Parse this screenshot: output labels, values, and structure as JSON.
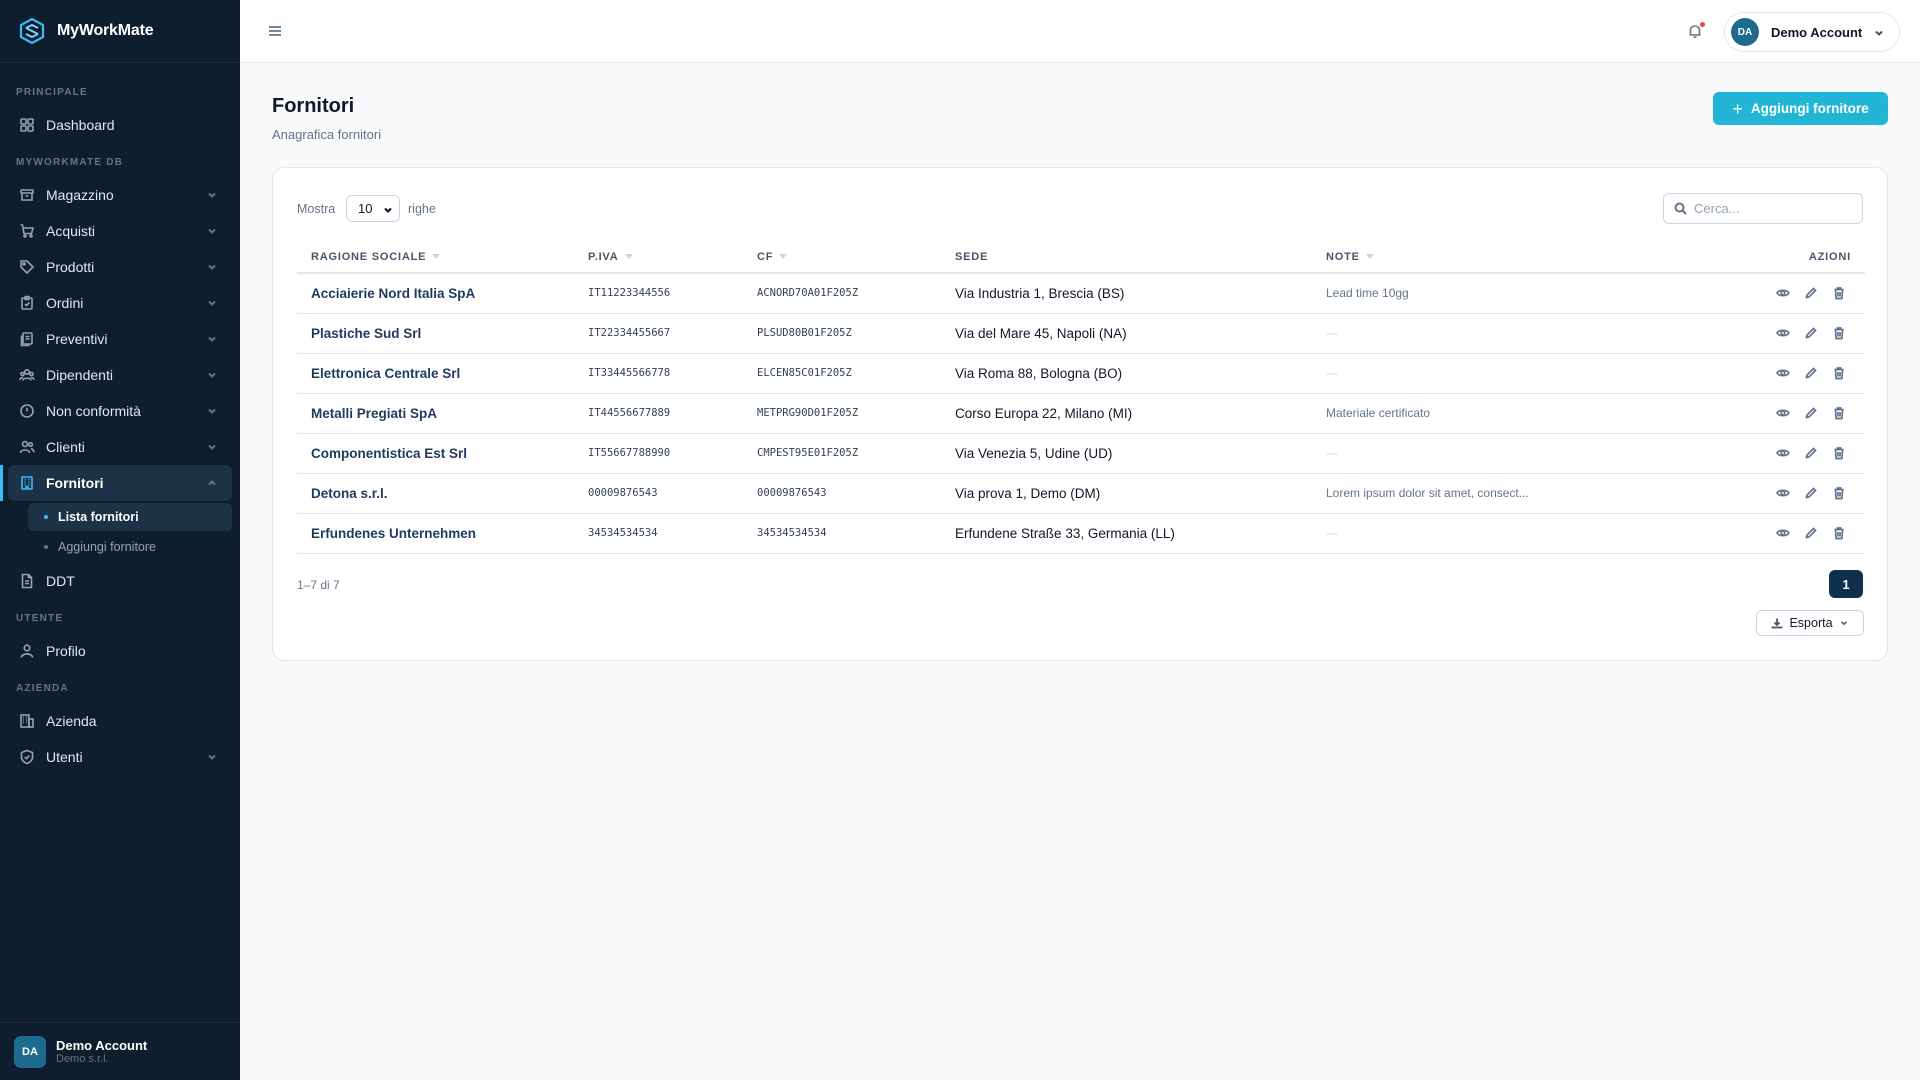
{
  "app": {
    "name": "MyWorkMate"
  },
  "sidebar": {
    "sections": {
      "principale": "PRINCIPALE",
      "db": "MYWORKMATE DB",
      "utente": "UTENTE",
      "azienda": "AZIENDA"
    },
    "items": {
      "dashboard": "Dashboard",
      "magazzino": "Magazzino",
      "acquisti": "Acquisti",
      "prodotti": "Prodotti",
      "ordini": "Ordini",
      "preventivi": "Preventivi",
      "dipendenti": "Dipendenti",
      "non_conformita": "Non conformità",
      "clienti": "Clienti",
      "fornitori": "Fornitori",
      "lista_fornitori": "Lista fornitori",
      "aggiungi_fornitore": "Aggiungi fornitore",
      "ddt": "DDT",
      "profilo": "Profilo",
      "azienda": "Azienda",
      "utenti": "Utenti"
    },
    "footer": {
      "initials": "DA",
      "name": "Demo Account",
      "company": "Demo s.r.l."
    }
  },
  "topbar": {
    "account_initials": "DA",
    "account_name": "Demo Account"
  },
  "page": {
    "title": "Fornitori",
    "subtitle": "Anagrafica fornitori",
    "add_button": "Aggiungi fornitore"
  },
  "table_controls": {
    "show_label": "Mostra",
    "rows_per_page": "10",
    "rows_label": "righe",
    "search_placeholder": "Cerca..."
  },
  "table": {
    "headers": {
      "ragione_sociale": "RAGIONE SOCIALE",
      "piva": "P.IVA",
      "cf": "CF",
      "sede": "SEDE",
      "note": "NOTE",
      "azioni": "AZIONI"
    },
    "rows": [
      {
        "name": "Acciaierie Nord Italia SpA",
        "piva": "IT11223344556",
        "cf": "ACNORD70A01F205Z",
        "sede": "Via Industria 1, Brescia (BS)",
        "note": "Lead time 10gg"
      },
      {
        "name": "Plastiche Sud Srl",
        "piva": "IT22334455667",
        "cf": "PLSUD80B01F205Z",
        "sede": "Via del Mare 45, Napoli (NA)",
        "note": "—"
      },
      {
        "name": "Elettronica Centrale Srl",
        "piva": "IT33445566778",
        "cf": "ELCEN85C01F205Z",
        "sede": "Via Roma 88, Bologna (BO)",
        "note": "—"
      },
      {
        "name": "Metalli Pregiati SpA",
        "piva": "IT44556677889",
        "cf": "METPRG90D01F205Z",
        "sede": "Corso Europa 22, Milano (MI)",
        "note": "Materiale certificato"
      },
      {
        "name": "Componentistica Est Srl",
        "piva": "IT55667788990",
        "cf": "CMPEST95E01F205Z",
        "sede": "Via Venezia 5, Udine (UD)",
        "note": "—"
      },
      {
        "name": "Detona s.r.l.",
        "piva": "00009876543",
        "cf": "00009876543",
        "sede": "Via prova 1, Demo (DM)",
        "note": "Lorem ipsum dolor sit amet, consect..."
      },
      {
        "name": "Erfundenes Unternehmen",
        "piva": "34534534534",
        "cf": "34534534534",
        "sede": "Erfundene Straße 33, Germania (LL)",
        "note": "—"
      }
    ]
  },
  "pagination": {
    "info": "1–7 di 7",
    "current_page": "1"
  },
  "export": {
    "label": "Esporta"
  },
  "colors": {
    "accent": "#22b5d6",
    "sidebar_bg": "#0f1e2e",
    "active_indicator": "#38bdf8",
    "page_btn": "#0f2f4f"
  }
}
